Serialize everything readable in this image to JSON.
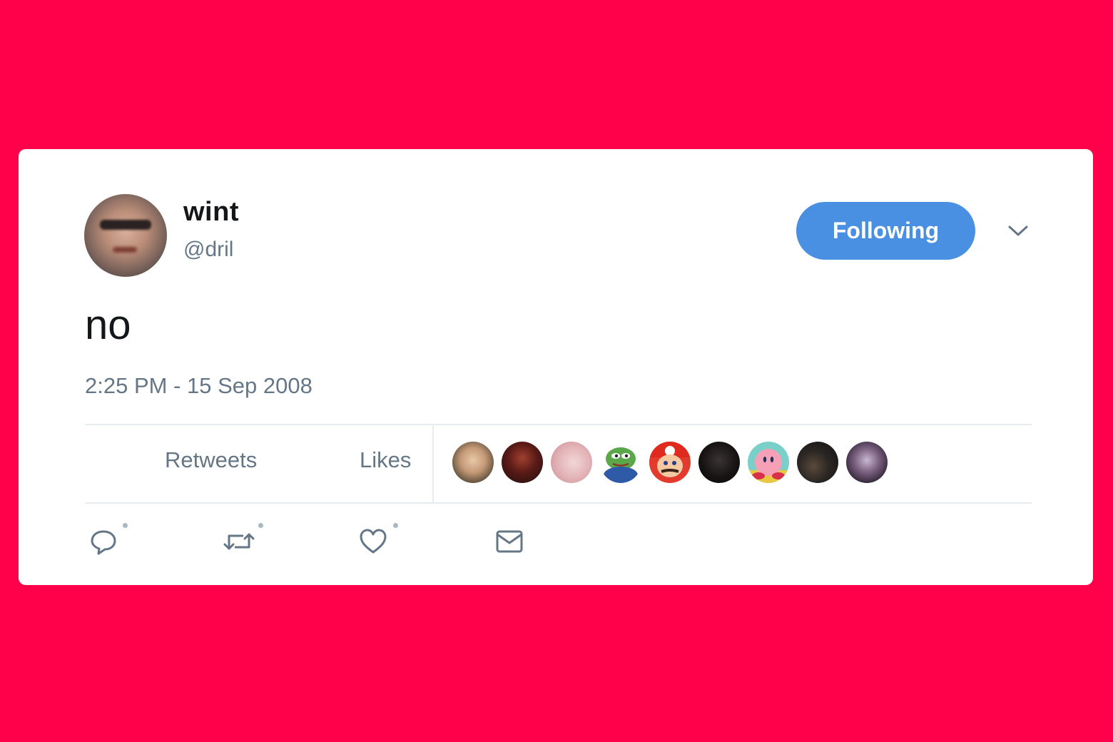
{
  "tweet": {
    "author": {
      "name": "wint",
      "handle": "@dril"
    },
    "follow_button_label": "Following",
    "text": "no",
    "timestamp": "2:25 PM - 15 Sep 2008"
  },
  "stats": {
    "retweets_label": "Retweets",
    "likes_label": "Likes"
  },
  "likers": [
    {
      "name": "liker-avatar-man-headphones"
    },
    {
      "name": "liker-avatar-dark-red"
    },
    {
      "name": "liker-avatar-pink-face"
    },
    {
      "name": "liker-avatar-pepe-frog"
    },
    {
      "name": "liker-avatar-mario"
    },
    {
      "name": "liker-avatar-dark-person"
    },
    {
      "name": "liker-avatar-kirby"
    },
    {
      "name": "liker-avatar-dark-scene"
    },
    {
      "name": "liker-avatar-purple-figure"
    }
  ],
  "actions": [
    {
      "name": "reply-icon"
    },
    {
      "name": "retweet-icon"
    },
    {
      "name": "like-icon"
    },
    {
      "name": "direct-message-icon"
    }
  ],
  "colors": {
    "background": "#ff004b",
    "card": "#ffffff",
    "follow_button": "#4a90e2",
    "secondary_text": "#657786",
    "divider": "#e6ecf0",
    "icon": "#657786"
  }
}
